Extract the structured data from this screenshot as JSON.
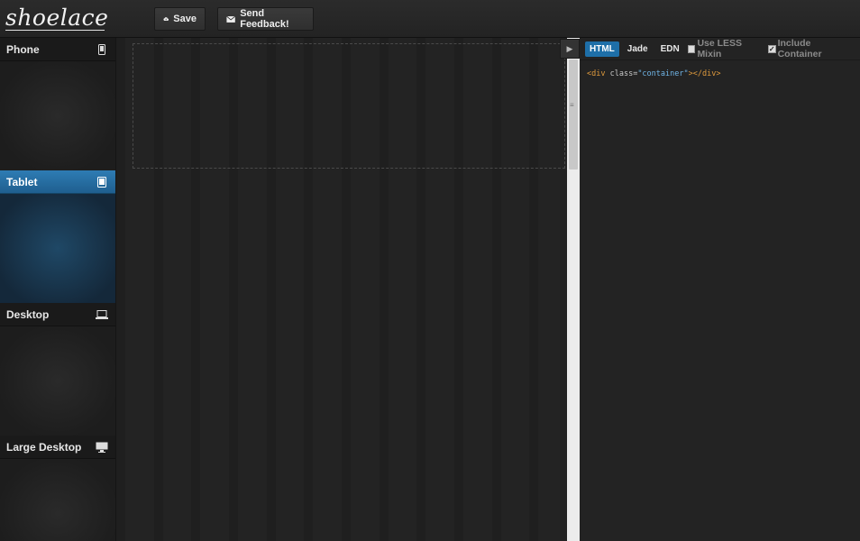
{
  "header": {
    "logo": "shoelace",
    "save_label": "Save",
    "feedback_label": "Send Feedback!"
  },
  "sidebar": {
    "items": [
      {
        "label": "Phone",
        "icon": "phone-icon",
        "active": false
      },
      {
        "label": "Tablet",
        "icon": "tablet-icon",
        "active": true
      },
      {
        "label": "Desktop",
        "icon": "laptop-icon",
        "active": false
      },
      {
        "label": "Large Desktop",
        "icon": "monitor-icon",
        "active": false
      }
    ]
  },
  "panel": {
    "tabs": [
      "HTML",
      "Jade",
      "EDN"
    ],
    "active_tab": "HTML",
    "option_less": "Use LESS Mixin",
    "option_less_checked": false,
    "option_container": "Include Container",
    "option_container_checked": true,
    "code": {
      "open_tag": "<div",
      "attr": " class=",
      "value": "\"container\"",
      "close": "></div>"
    }
  },
  "colors": {
    "accent": "#1e6fa8",
    "background": "#1c1c1c"
  }
}
